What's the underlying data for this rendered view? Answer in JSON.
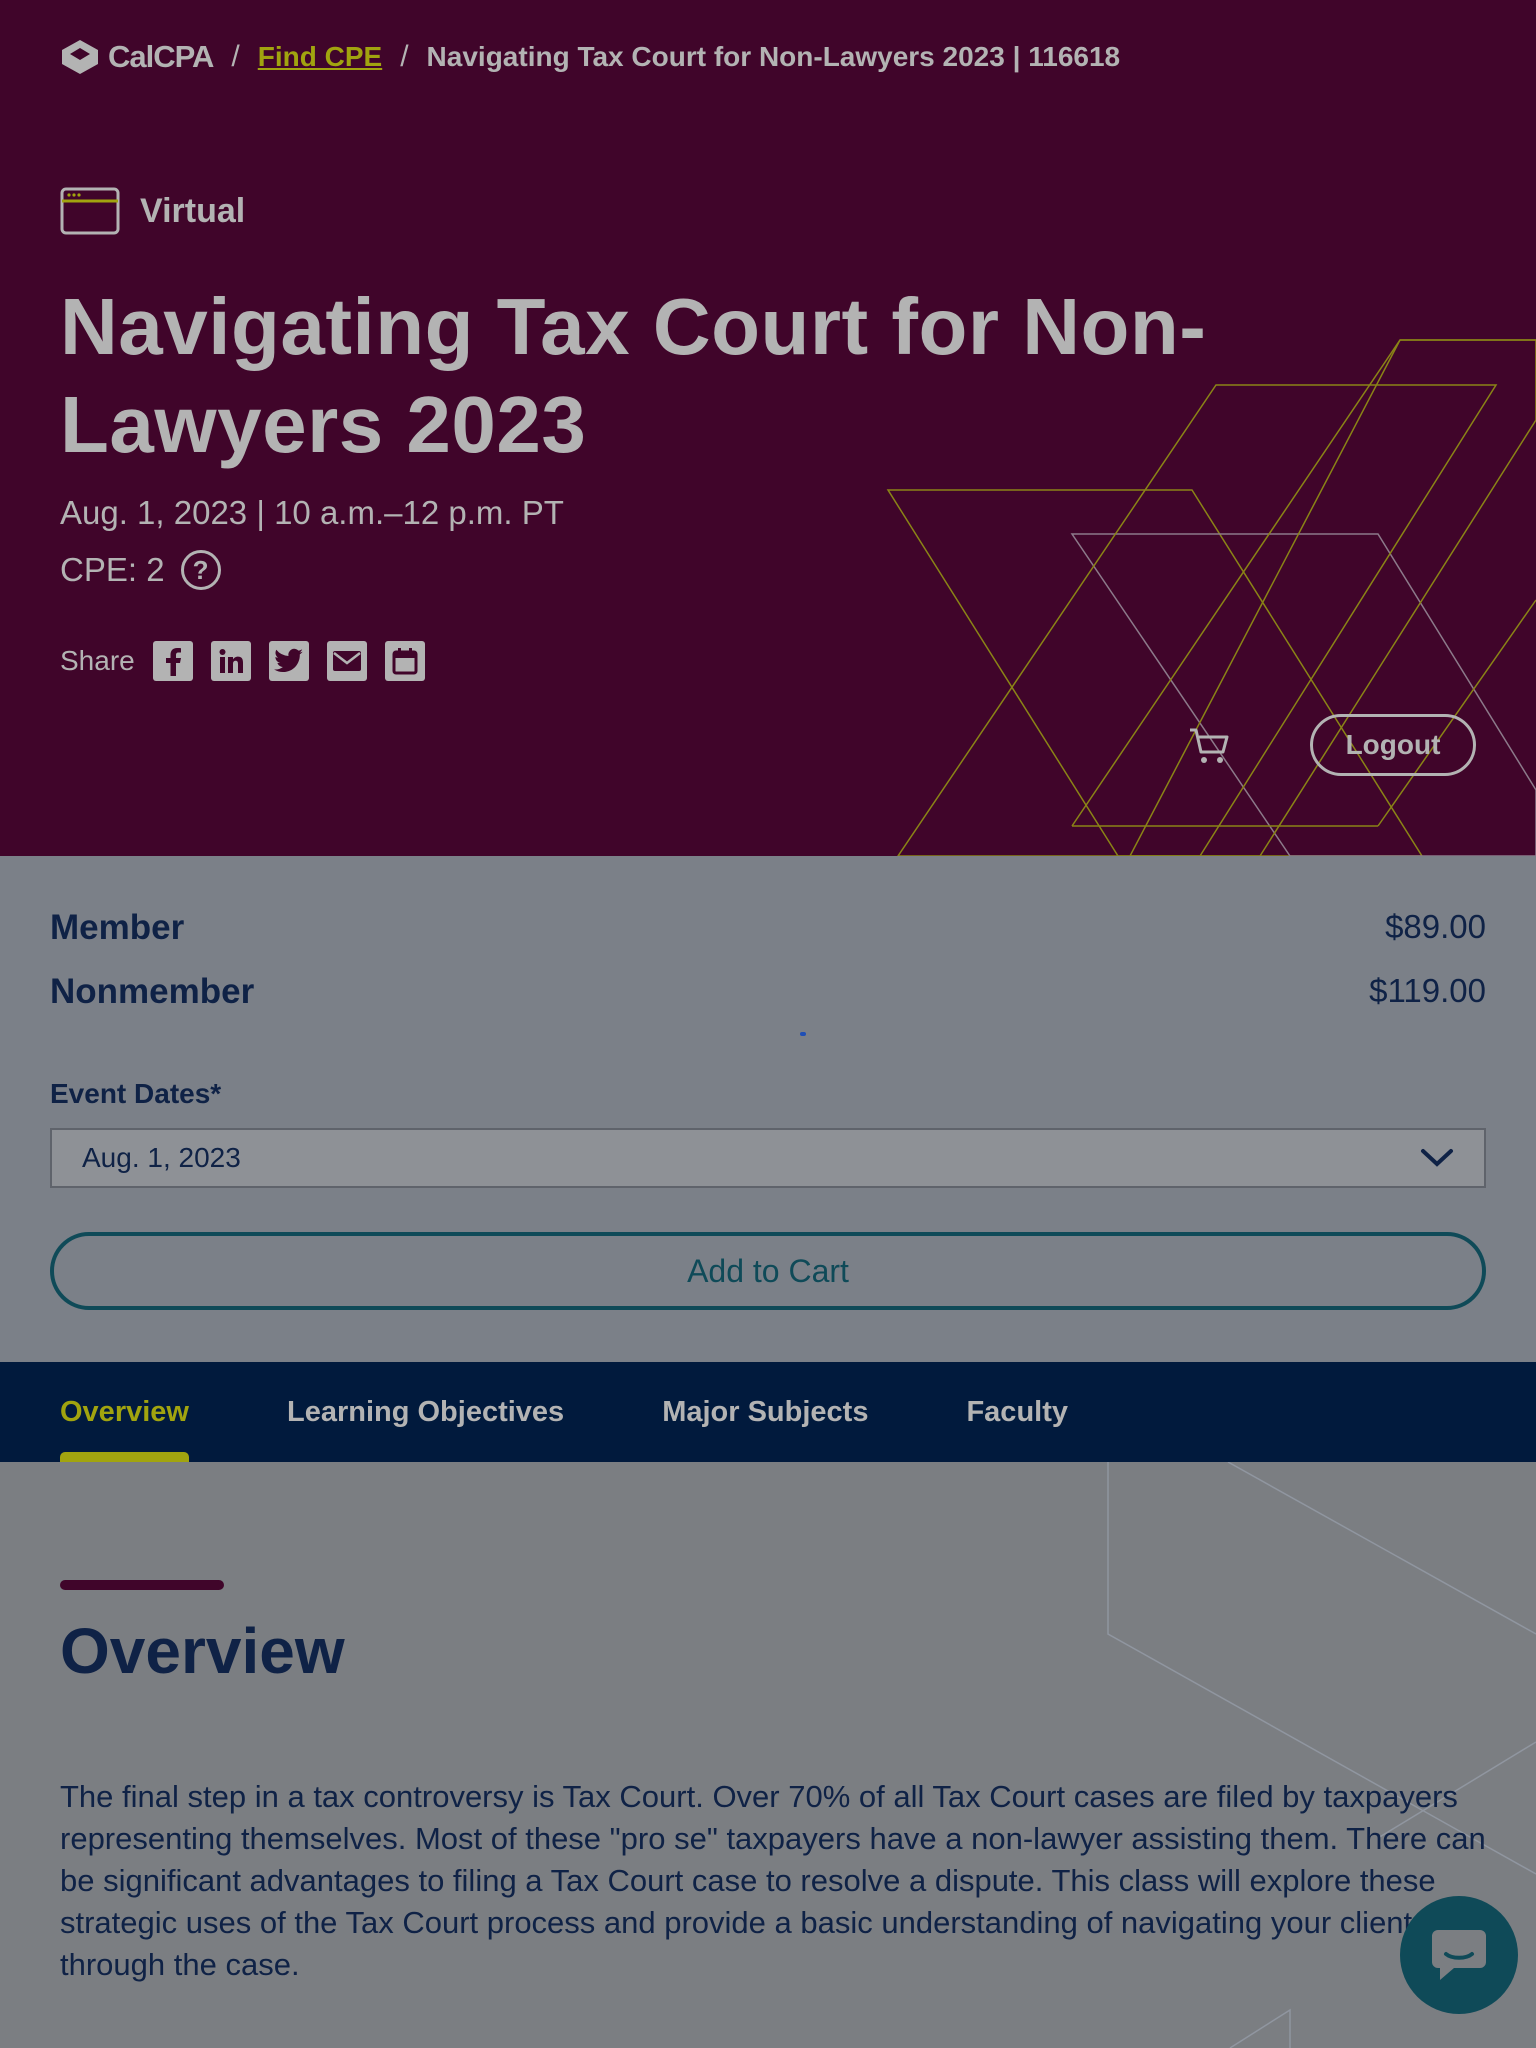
{
  "breadcrumb": {
    "logo": "CalCPA",
    "separator": "/",
    "link": "Find CPE",
    "current": "Navigating Tax Court for Non-Lawyers 2023 | 116618"
  },
  "event": {
    "format": "Virtual",
    "title": "Navigating Tax Court for Non-Lawyers 2023",
    "date_time": "Aug. 1, 2023 | 10 a.m.–12 p.m. PT",
    "cpe": "CPE: 2",
    "help": "?"
  },
  "share": {
    "label": "Share",
    "icons": [
      "facebook-icon",
      "linkedin-icon",
      "twitter-icon",
      "email-icon",
      "calendar-icon"
    ]
  },
  "header_actions": {
    "logout": "Logout"
  },
  "pricing": {
    "member_label": "Member",
    "member_price": "$89.00",
    "nonmember_label": "Nonmember",
    "nonmember_price": "$119.00",
    "event_dates_label": "Event Dates*",
    "selected_date": "Aug. 1, 2023",
    "add_to_cart": "Add to Cart"
  },
  "tabs": [
    {
      "label": "Overview",
      "active": true
    },
    {
      "label": "Learning Objectives",
      "active": false
    },
    {
      "label": "Major Subjects",
      "active": false
    },
    {
      "label": "Faculty",
      "active": false
    }
  ],
  "overview": {
    "heading": "Overview",
    "body": "The final step in a tax controversy is Tax Court. Over 70% of all Tax Court cases are filed by taxpayers representing themselves. Most of these \"pro se\" taxpayers have a non-lawyer assisting them. There can be significant advantages to filing a Tax Court case to resolve a dispute. This class will explore these strategic uses of the Tax Court process and provide a basic understanding of navigating your client through the case."
  },
  "colors": {
    "hero_bg": "#40052a",
    "accent": "#a1a40f",
    "navy": "#0f2246",
    "teal": "#0f4a58"
  }
}
